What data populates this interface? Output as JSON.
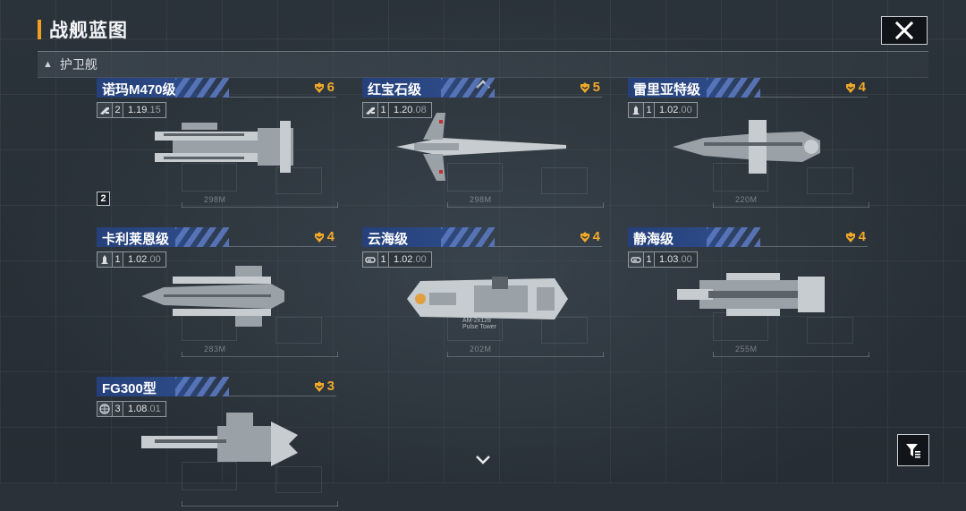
{
  "header": {
    "title": "战舰蓝图"
  },
  "section": {
    "label": "护卫舰",
    "collapse_icon": "triangle-up-icon"
  },
  "colors": {
    "accent": "#f0a020",
    "card_header": "#2c4a86",
    "rank": "#f0a92a"
  },
  "ships": [
    {
      "name": "诺玛M470级",
      "rank": "6",
      "type_icon": "sniper-icon",
      "tier": "2",
      "version_main": "1.19",
      "version_sub": ".15",
      "length": "298M",
      "tech_badge": "2"
    },
    {
      "name": "红宝石级",
      "rank": "5",
      "type_icon": "sniper-icon",
      "tier": "1",
      "version_main": "1.20",
      "version_sub": ".08",
      "length": "298M",
      "tech_badge": ""
    },
    {
      "name": "雷里亚特级",
      "rank": "4",
      "type_icon": "missile-icon",
      "tier": "1",
      "version_main": "1.02",
      "version_sub": ".00",
      "length": "220M",
      "tech_badge": ""
    },
    {
      "name": "卡利莱恩级",
      "rank": "4",
      "type_icon": "missile-icon",
      "tier": "1",
      "version_main": "1.02",
      "version_sub": ".00",
      "length": "283M",
      "tech_badge": ""
    },
    {
      "name": "云海级",
      "rank": "4",
      "type_icon": "carrier-icon",
      "tier": "1",
      "version_main": "1.02",
      "version_sub": ".00",
      "length": "202M",
      "tech_badge": "",
      "annotation": "AM-2x128",
      "annotation_sub": "Pulse Tower"
    },
    {
      "name": "静海级",
      "rank": "4",
      "type_icon": "carrier-icon",
      "tier": "1",
      "version_main": "1.03",
      "version_sub": ".00",
      "length": "255M",
      "tech_badge": ""
    },
    {
      "name": "FG300型",
      "rank": "3",
      "type_icon": "globe-icon",
      "tier": "3",
      "version_main": "1.08",
      "version_sub": ".01",
      "length": "",
      "tech_badge": ""
    }
  ],
  "controls": {
    "close": "close-icon",
    "scroll_up": "chevron-up-icon",
    "scroll_down": "chevron-down-icon",
    "filter": "filter-icon"
  }
}
